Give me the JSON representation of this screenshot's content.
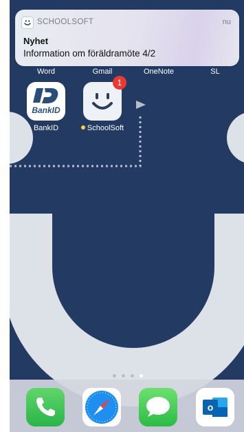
{
  "notification": {
    "app_name": "SCHOOLSOFT",
    "time": "nu",
    "title": "Nyhet",
    "body": "Information om föräldramöte 4/2"
  },
  "top_row_labels": [
    "Word",
    "Gmail",
    "OneNote",
    "SL"
  ],
  "apps": [
    {
      "label": "BankID",
      "icon": "bankid-icon",
      "icon_text": "BankID"
    },
    {
      "label": "SchoolSoft",
      "icon": "schoolsoft-icon",
      "badge": "1",
      "new_indicator_color": "#f5d33b"
    }
  ],
  "page_indicator": {
    "pages": 4,
    "active_index": 3
  },
  "dock": [
    {
      "name": "phone",
      "icon": "phone-icon"
    },
    {
      "name": "safari",
      "icon": "safari-icon"
    },
    {
      "name": "messages",
      "icon": "messages-icon"
    },
    {
      "name": "outlook",
      "icon": "outlook-icon",
      "icon_text": "o"
    }
  ],
  "colors": {
    "wallpaper_blue": "#233b63",
    "wallpaper_light": "#dde1e8",
    "badge_red": "#e83a33"
  }
}
